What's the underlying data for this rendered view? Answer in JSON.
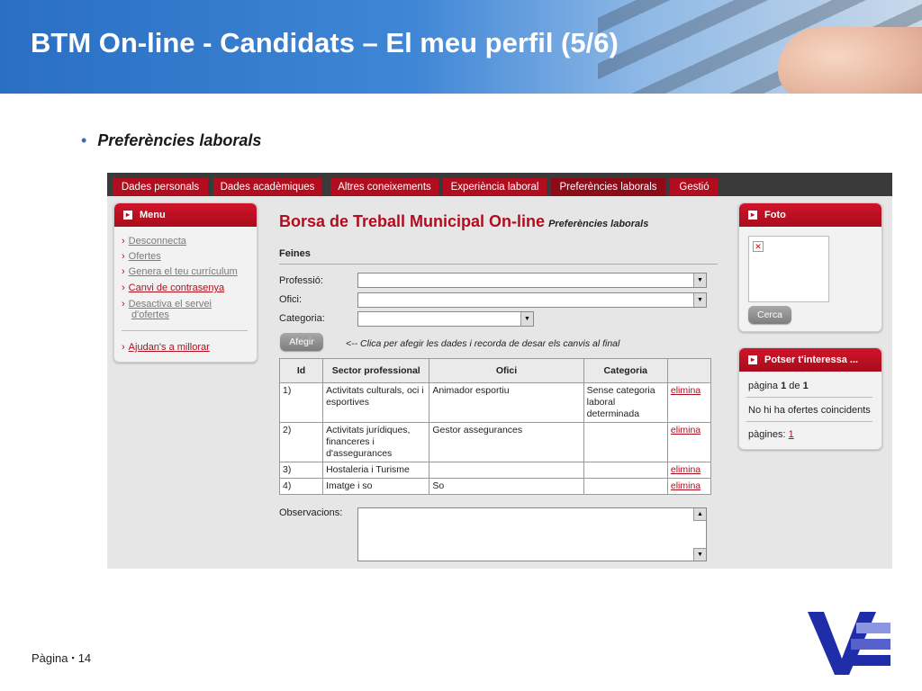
{
  "slide": {
    "title": "BTM On-line - Candidats – El meu perfil (5/6)",
    "bullet": "Preferències laborals",
    "footer_label": "Pàgina",
    "footer_sep": "▪",
    "page_number": "14"
  },
  "tabs": [
    "Dades personals",
    "Dades acadèmiques",
    "Altres coneixements",
    "Experiència laboral",
    "Preferències laborals",
    "Gestió"
  ],
  "active_tab": "Preferències laborals",
  "menu": {
    "title": "Menu",
    "items": [
      "Desconnecta",
      "Ofertes",
      "Genera el teu currículum",
      "Canvi de contrasenya",
      "Desactiva el servei",
      "d'ofertes",
      "Ajudan's a millorar"
    ]
  },
  "main": {
    "title": "Borsa de Treball Municipal On-line",
    "subtitle": "Preferències laborals",
    "section": "Feines",
    "professio_label": "Professió:",
    "professio_value": "",
    "ofici_label": "Ofici:",
    "ofici_value": "",
    "categoria_label": "Categoria:",
    "categoria_value": "",
    "add_button": "Afegir",
    "hint": "<-- Clica per afegir les dades i recorda de desar els canvis al final",
    "table": {
      "headers": [
        "Id",
        "Sector professional",
        "Ofici",
        "Categoria",
        ""
      ],
      "rows": [
        {
          "id": "1)",
          "sector_1": "Activitats culturals, oci i",
          "sector_2": "esportives",
          "sector_3": "",
          "ofici": "Animador esportiu",
          "cat_1": "Sense categoria",
          "cat_2": "laboral",
          "cat_3": "determinada",
          "action": "elimina"
        },
        {
          "id": "2)",
          "sector_1": "Activitats jurídiques,",
          "sector_2": "financeres i",
          "sector_3": "d'assegurances",
          "ofici": "Gestor assegurances",
          "cat_1": "",
          "cat_2": "",
          "cat_3": "",
          "action": "elimina"
        },
        {
          "id": "3)",
          "sector_1": "Hostaleria i Turisme",
          "sector_2": "",
          "sector_3": "",
          "ofici": "",
          "cat_1": "",
          "cat_2": "",
          "cat_3": "",
          "action": "elimina"
        },
        {
          "id": "4)",
          "sector_1": "Imatge i so",
          "sector_2": "",
          "sector_3": "",
          "ofici": "So",
          "cat_1": "",
          "cat_2": "",
          "cat_3": "",
          "action": "elimina"
        }
      ]
    },
    "observacions_label": "Observacions:",
    "observacions_value": ""
  },
  "foto": {
    "title": "Foto",
    "button": "Cerca"
  },
  "interest": {
    "title": "Potser t'interessa ...",
    "page_label": "pàgina",
    "page_current": "1",
    "page_of": "de",
    "page_total": "1",
    "no_offers": "No hi ha ofertes coincidents",
    "pages_label": "pàgines:",
    "pages_link": "1"
  },
  "colors": {
    "accent": "#b20d1e",
    "header_blue": "#2a6fc2",
    "logo_blue": "#1f2ea8"
  }
}
